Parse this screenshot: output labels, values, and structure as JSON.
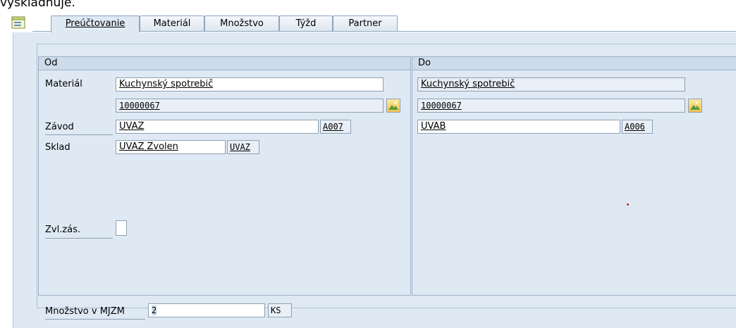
{
  "header": {
    "partial_text": "vyskladňuje."
  },
  "tabs": [
    {
      "label": "Preúčtovanie",
      "active": true
    },
    {
      "label": "Materiál",
      "active": false
    },
    {
      "label": "Množstvo",
      "active": false
    },
    {
      "label": "Týžd",
      "active": false
    },
    {
      "label": "Partner",
      "active": false
    }
  ],
  "from": {
    "title": "Od",
    "material_label": "Materiál",
    "material_name": "Kuchynský spotrebič",
    "material_number": "10000067",
    "plant_label": "Závod",
    "plant_value": "UVAZ",
    "plant_code": "A007",
    "storage_label": "Sklad",
    "storage_value": "UVAZ Zvolen",
    "storage_code": "UVAZ",
    "special_stock_label": "Zvl.zás."
  },
  "to": {
    "title": "Do",
    "material_name": "Kuchynský spotrebič",
    "material_number": "10000067",
    "plant_value": "UVAB",
    "plant_code": "A006"
  },
  "quantity": {
    "label": "Množstvo v MJZM",
    "value": "2",
    "unit": "KS"
  },
  "icons": {
    "expand": "tree-expand-icon",
    "picker": "image-picker-icon"
  }
}
